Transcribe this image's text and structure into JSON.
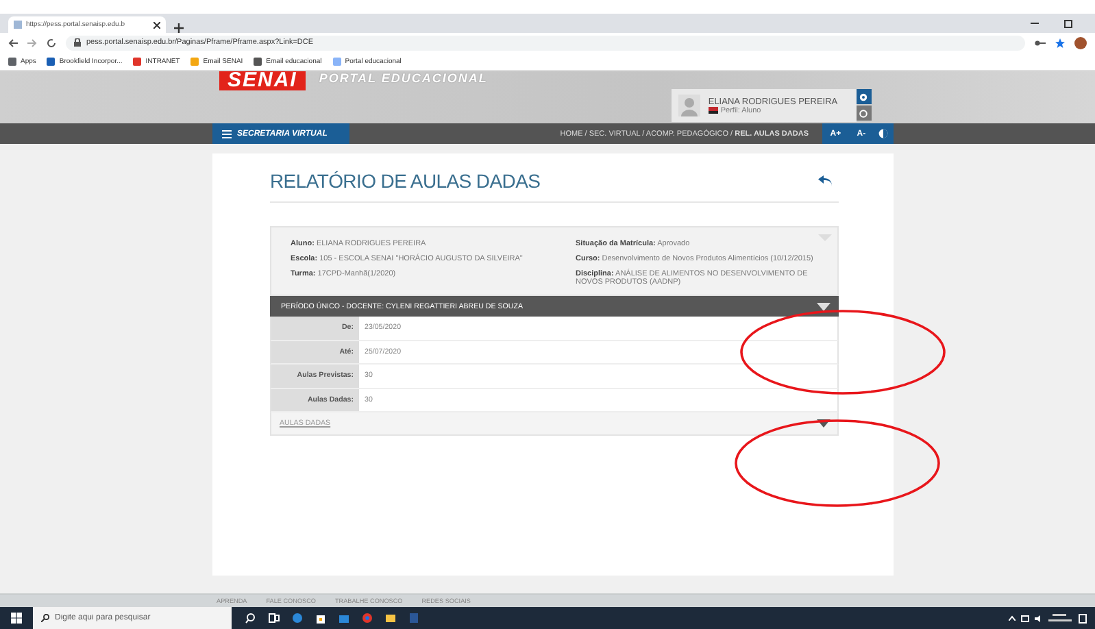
{
  "browser": {
    "tab_title": "https://pess.portal.senaisp.edu.b",
    "address": "pess.portal.senaisp.edu.br/Paginas/Pframe/Pframe.aspx?Link=DCE",
    "bookmarks": [
      {
        "label": "Apps",
        "color": "#5f6368"
      },
      {
        "label": "Brookfield Incorpor...",
        "color": "#1a5fb4"
      },
      {
        "label": "INTRANET",
        "color": "#e0352b"
      },
      {
        "label": "Email SENAI",
        "color": "#f3a712"
      },
      {
        "label": "Email educacional",
        "color": "#555555"
      },
      {
        "label": "Portal educacional",
        "color": "#8ab4f8"
      }
    ]
  },
  "portal": {
    "logo": "SENAI",
    "subtitle": "PORTAL EDUCACIONAL",
    "user": {
      "name": "ELIANA RODRIGUES PEREIRA",
      "profile": "Perfil: Aluno"
    },
    "nav": {
      "title": "SECRETARIA VIRTUAL",
      "breadcrumbs": "HOME / SEC. VIRTUAL / ACOMP. PEDAGÓGICO / **REL. AULAS DADAS**",
      "font_buttons": [
        "A+",
        "A-"
      ]
    }
  },
  "report": {
    "title": "RELATÓRIO DE AULAS DADAS",
    "info_left": [
      "**Aluno:** ELIANA RODRIGUES PEREIRA",
      "**Escola:** 105 - ESCOLA SENAI \"HORÁCIO AUGUSTO DA SILVEIRA\"",
      "**Turma:** 17CPD-Manhã(1/2020)"
    ],
    "info_right": [
      "**Situação da Matrícula:** Aprovado",
      "**Curso:** Desenvolvimento de Novos Produtos Alimentícios (10/12/2015)",
      "**Disciplina:** ANÁLISE DE ALIMENTOS NO DESENVOLVIMENTO DE NOVOS PRODUTOS (AADNP)"
    ],
    "period_header": "PERÍODO ÚNICO - DOCENTE: CYLENI REGATTIERI ABREU DE SOUZA",
    "rows": [
      {
        "label": "De:",
        "value": "23/05/2020"
      },
      {
        "label": "Até:",
        "value": "25/07/2020"
      },
      {
        "label": "Aulas Previstas:",
        "value": "30"
      },
      {
        "label": "Aulas Dadas:",
        "value": "30"
      }
    ],
    "section_link": "AULAS DADAS"
  },
  "footer_links": [
    "APRENDA",
    "FALE CONOSCO",
    "TRABALHE CONOSCO",
    "REDES SOCIAIS"
  ],
  "taskbar": {
    "search_placeholder": "Digite aqui para pesquisar"
  },
  "annotations": [
    {
      "kind": "ellipse"
    },
    {
      "kind": "ellipse"
    }
  ]
}
